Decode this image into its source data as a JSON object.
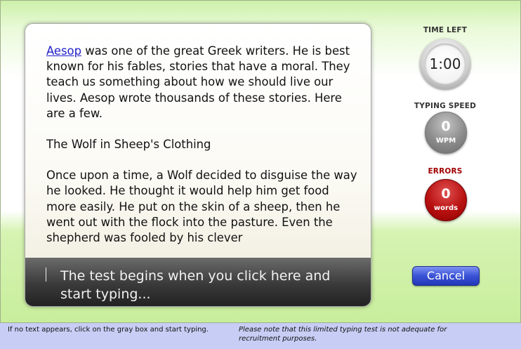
{
  "passage": {
    "link_text": "Aesop",
    "paragraph1_rest": " was one of the great Greek writers. He is best known for his fables, stories that have a moral. They teach us something about how we should live our lives. Aesop wrote thousands of these stories. Here are a few.",
    "story_title": "The Wolf in Sheep's Clothing",
    "paragraph2": "Once upon a time, a Wolf decided to disguise the way he looked. He thought it would help him get food more easily. He put on the skin of a sheep, then he went out with the flock into the pasture. Even the shepherd was fooled by his clever"
  },
  "input": {
    "prompt": "The test begins when you click here and start typing..."
  },
  "stats": {
    "time_left_label": "TIME LEFT",
    "time_left_value": "1:00",
    "speed_label": "TYPING SPEED",
    "speed_value": "0",
    "speed_unit": "WPM",
    "errors_label": "ERRORS",
    "errors_value": "0",
    "errors_unit": "words"
  },
  "cancel_label": "Cancel",
  "footer": {
    "left_note": "If no text appears, click on the gray box and start typing.",
    "right_note": "Please note that this limited typing test is not adequate for recruitment purposes."
  },
  "colors": {
    "link": "#2222cc",
    "time_label": "#333333",
    "speed_label": "#333333",
    "errors_label": "#a00000",
    "cancel_button": "#3a52d6",
    "footer_background": "#c7cdf4"
  }
}
